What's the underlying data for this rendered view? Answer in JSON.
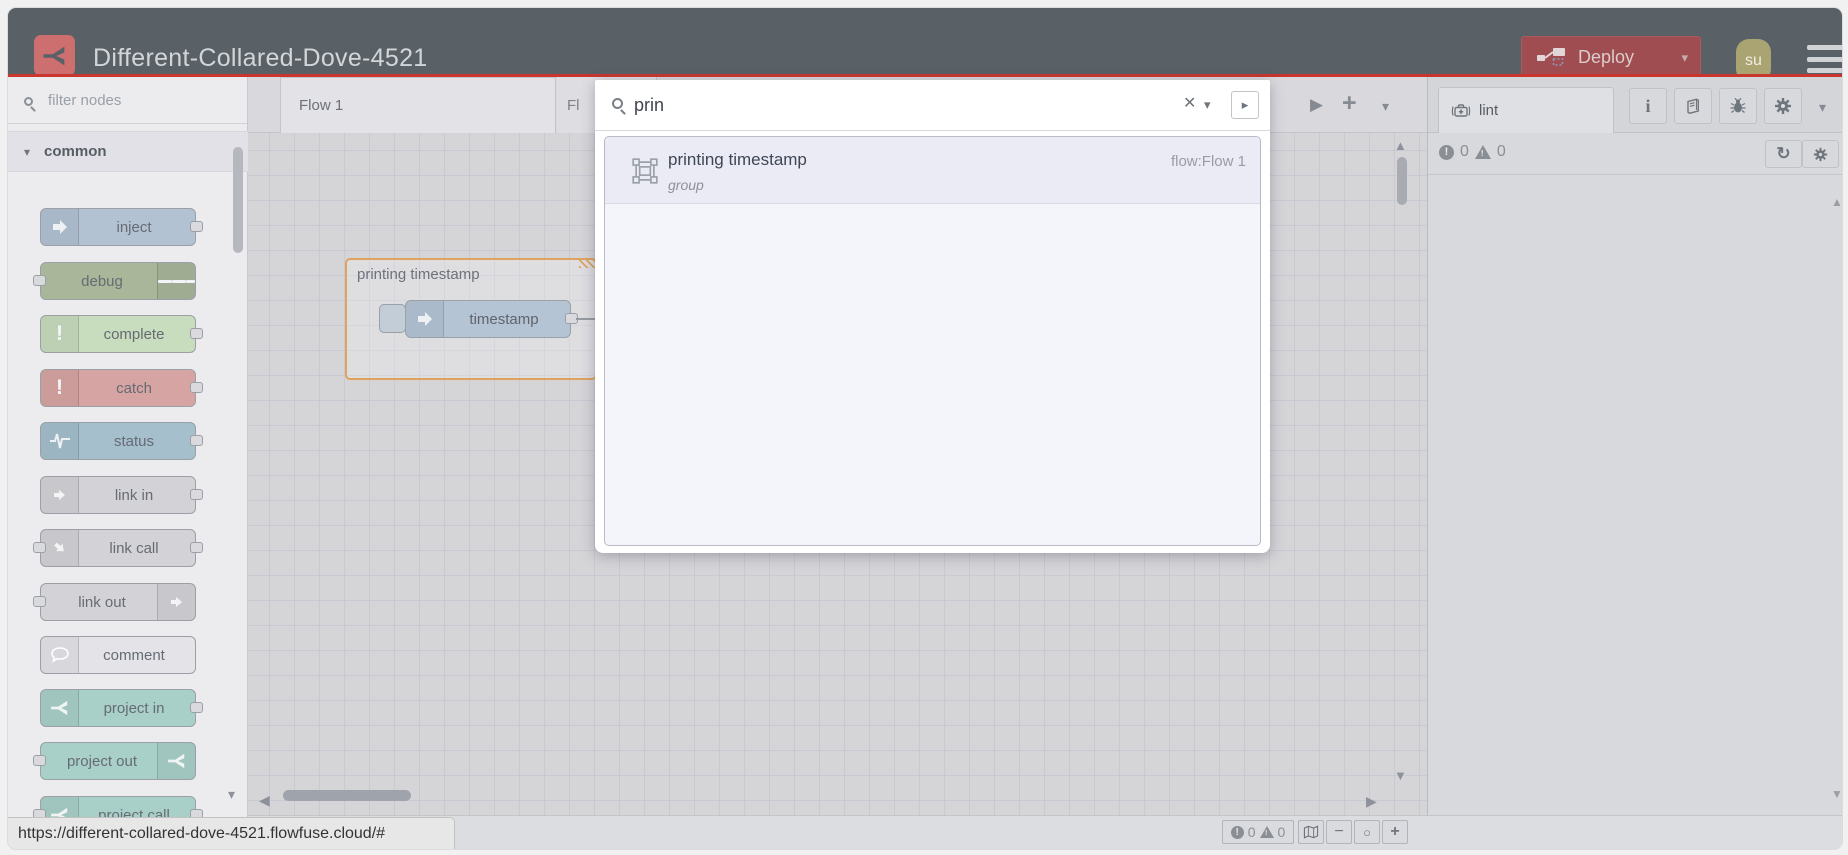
{
  "header": {
    "title": "Different-Collared-Dove-4521",
    "deploy_label": "Deploy",
    "avatar_initials": "su"
  },
  "palette": {
    "filter_placeholder": "filter nodes",
    "category_label": "common",
    "nodes": [
      {
        "label": "inject",
        "color": "#b3c2d3"
      },
      {
        "label": "debug",
        "color": "#a9b699"
      },
      {
        "label": "complete",
        "color": "#c8dcbe"
      },
      {
        "label": "catch",
        "color": "#d6a5a3"
      },
      {
        "label": "status",
        "color": "#a5bfcd"
      },
      {
        "label": "link in",
        "color": "#d3d3d7"
      },
      {
        "label": "link call",
        "color": "#d3d3d7"
      },
      {
        "label": "link out",
        "color": "#d3d3d7"
      },
      {
        "label": "comment",
        "color": "#e4e4e8"
      },
      {
        "label": "project in",
        "color": "#a8d0c9"
      },
      {
        "label": "project out",
        "color": "#a8d0c9"
      },
      {
        "label": "project call",
        "color": "#a8d0c9"
      }
    ]
  },
  "tabs": {
    "tab1_label": "Flow 1",
    "tab2_partial_label": "Fl"
  },
  "canvas": {
    "group_label": "printing timestamp",
    "node_label": "timestamp"
  },
  "search": {
    "query": "prin",
    "result": {
      "title": "printing timestamp",
      "subtitle": "group",
      "flow_label": "flow:Flow 1"
    }
  },
  "sidebar": {
    "tab_label": "lint",
    "error_count": "0",
    "warning_count": "0"
  },
  "canvas_footer": {
    "error_count": "0",
    "warning_count": "0"
  },
  "status_bar": {
    "url": "https://different-collared-dove-4521.flowfuse.cloud/#"
  },
  "colors": {
    "header_bg": "#596066",
    "accent_red_line": "#c8362e",
    "logo_bg": "#cd6f6e",
    "deploy_bg": "#9f4d50",
    "avatar_bg": "#aaa472",
    "group_border": "#dfa35e",
    "tab_dot": "#66aed2",
    "search_panel_bg": "#f4f4fb"
  }
}
